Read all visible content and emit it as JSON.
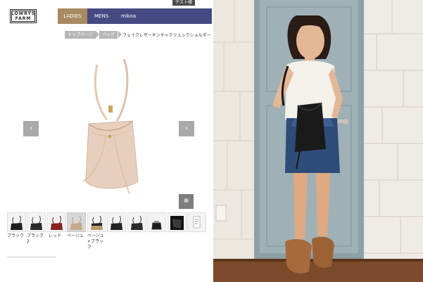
{
  "shop": {
    "guest_label": "ゲスト様",
    "logo_line1": "LOWRYS",
    "logo_line2": "FARM"
  },
  "nav": {
    "tabs": [
      {
        "label": "LADIES",
        "active": true
      },
      {
        "label": "MENS",
        "active": false
      },
      {
        "label": "mikoa",
        "active": false
      }
    ]
  },
  "breadcrumb": {
    "items": [
      "トップページ",
      "バッグ"
    ],
    "current": "フェイクレザーキンチャクリュックショルダー"
  },
  "gallery": {
    "prev_icon": "chevron-left-icon",
    "next_icon": "chevron-right-icon",
    "zoom_icon": "magnifier-plus-icon"
  },
  "colors": {
    "nav_bg": "#464a82",
    "nav_active": "#a88b62",
    "crumb_bg": "#b6b6b6"
  },
  "color_variants": [
    {
      "label": "ブラック",
      "swatch": "#1e1e1e"
    },
    {
      "label": "ブラック2",
      "swatch": "#2a2a2a"
    },
    {
      "label": "レッド",
      "swatch": "#8c1f22"
    },
    {
      "label": "ベージュ",
      "swatch": "#c8a98f"
    },
    {
      "label": "ベージュ×ブラック",
      "swatch": "#b89a6a"
    },
    {
      "label": "",
      "swatch": "#222222"
    },
    {
      "label": "",
      "swatch": "#2b2b2b"
    },
    {
      "label": "",
      "swatch": "#1b1b1b"
    },
    {
      "label": "",
      "swatch": "#111111"
    },
    {
      "label": "",
      "swatch": "#ffffff"
    }
  ]
}
